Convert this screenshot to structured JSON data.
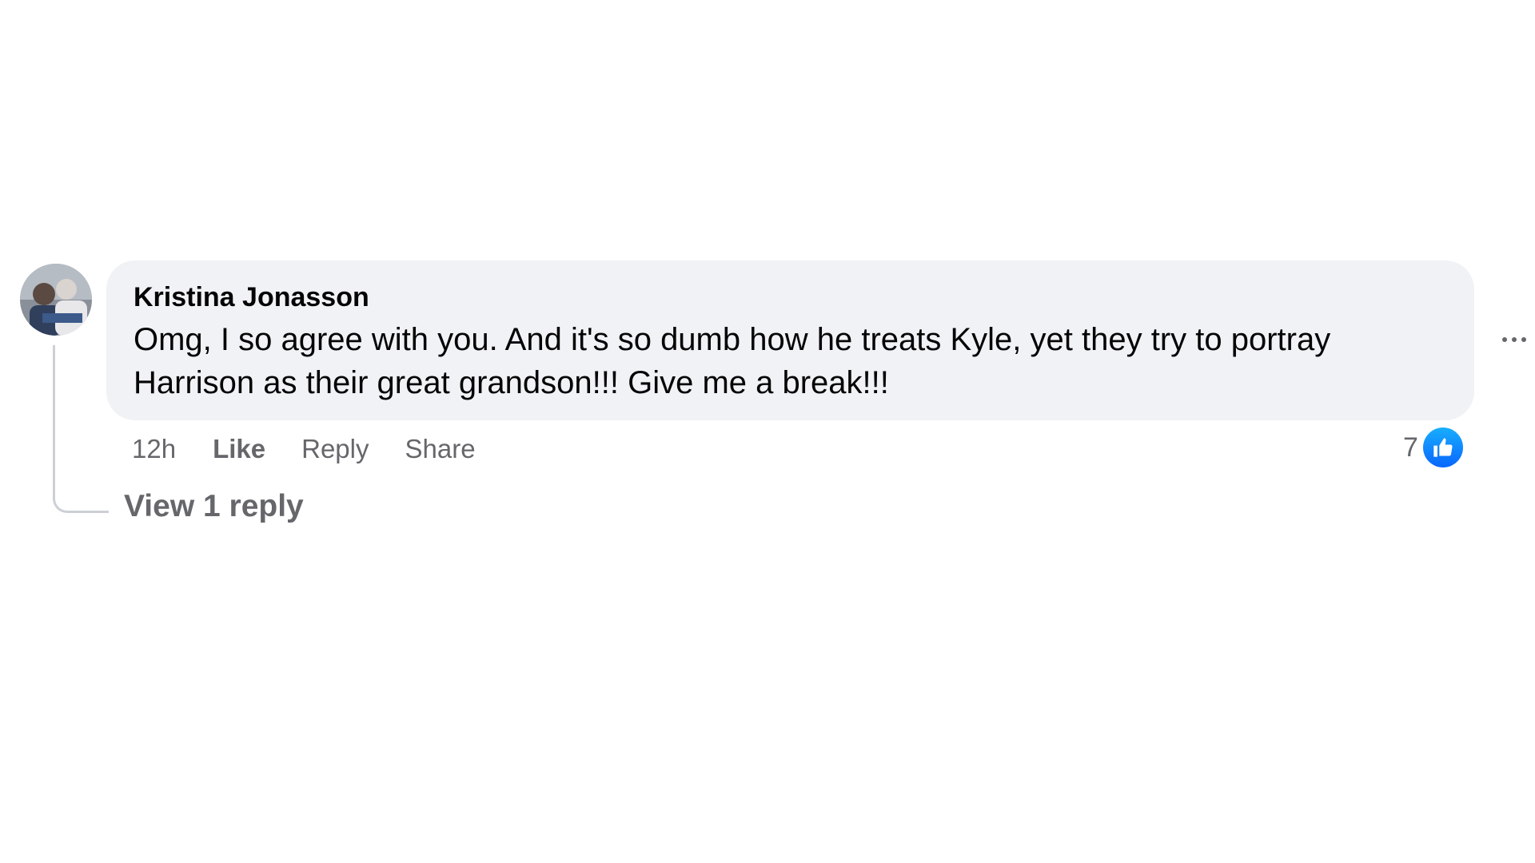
{
  "comment": {
    "author": "Kristina Jonasson",
    "text": "Omg, I so agree with you. And it's so dumb how he treats Kyle, yet they try to portray Harrison as their great grandson!!! Give me a break!!!",
    "time": "12h",
    "actions": {
      "like": "Like",
      "reply": "Reply",
      "share": "Share"
    },
    "reaction_count": "7",
    "reaction_icon": "thumbs-up-icon",
    "view_replies": "View 1 reply",
    "more_icon": "more-options-icon"
  },
  "colors": {
    "bubble_bg": "#f0f2f5",
    "secondary_text": "#65676b",
    "like_blue": "#0866ff",
    "thread_line": "#ccd0d5"
  }
}
